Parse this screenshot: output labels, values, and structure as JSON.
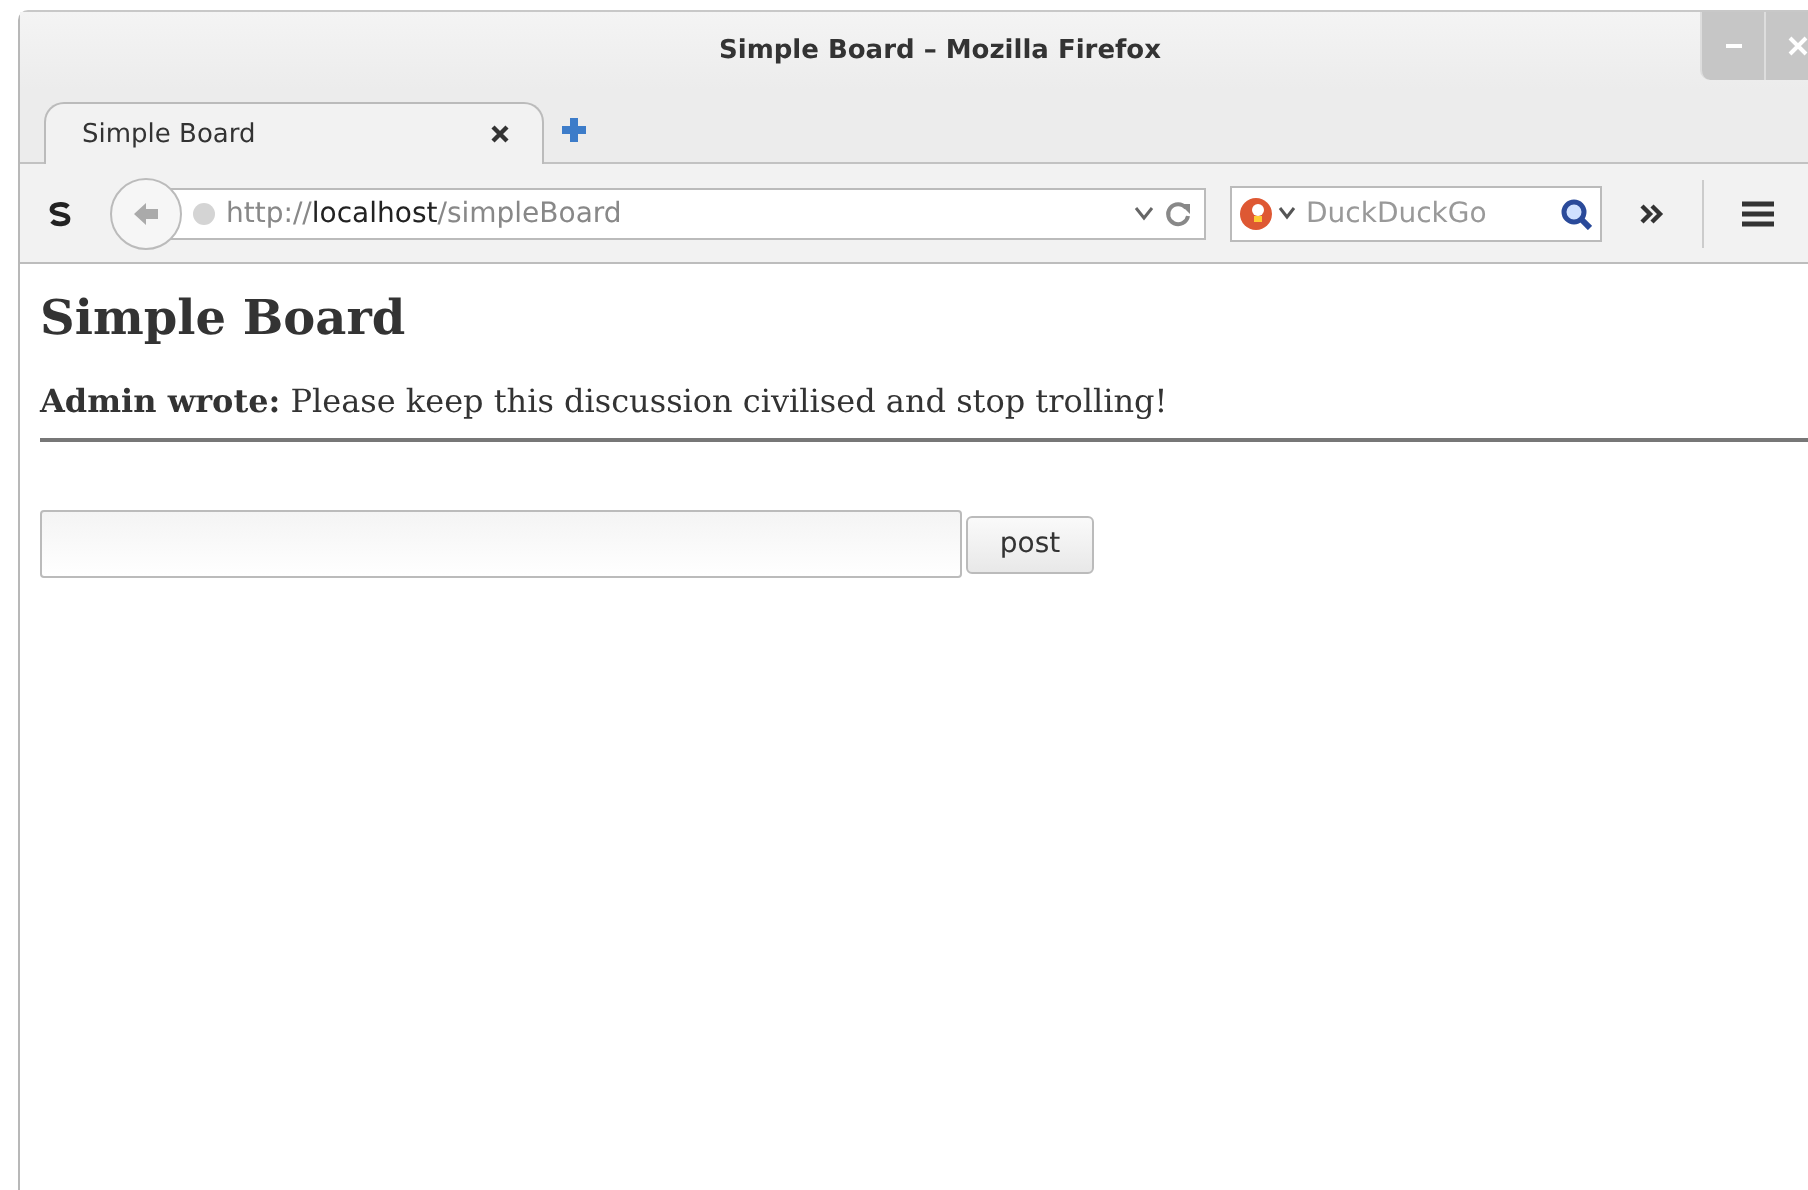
{
  "window": {
    "title": "Simple Board – Mozilla Firefox"
  },
  "tabs": [
    {
      "label": "Simple Board",
      "selected": true
    }
  ],
  "address_bar": {
    "url": "http://**localhost**/simpleBoard"
  },
  "search": {
    "placeholder": "DuckDuckGo"
  },
  "page": {
    "heading": "Simple Board",
    "posts": [
      {
        "text": "**Admin wrote:** Please keep this discussion civilised and stop trolling!"
      }
    ],
    "form": {
      "button": "post"
    }
  }
}
